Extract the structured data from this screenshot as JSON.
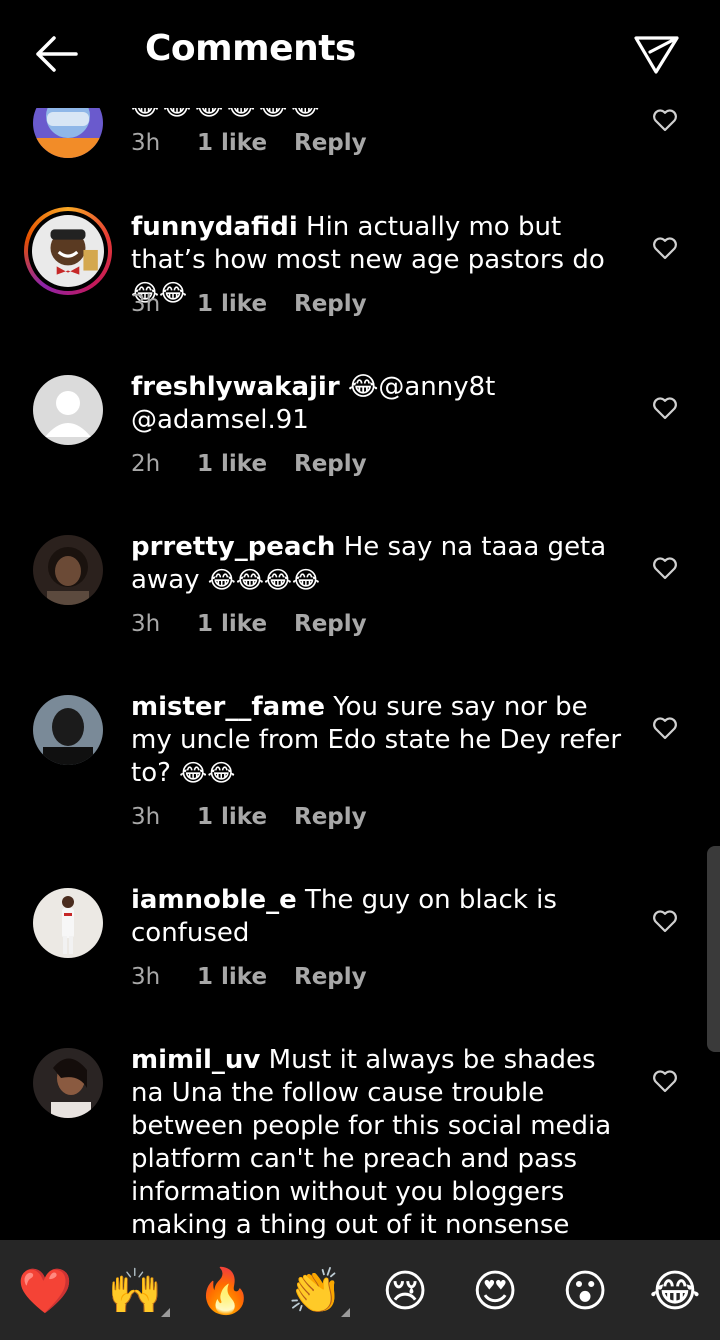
{
  "header": {
    "title": "Comments"
  },
  "icons": {
    "back": "back-arrow-icon",
    "share": "send-icon",
    "heart": "heart-outline-icon"
  },
  "partial_comment": {
    "time": "3h",
    "likes": "1 like",
    "reply": "Reply"
  },
  "comments": [
    {
      "username": "funnydafidi",
      "text": "Hin actually mo but that’s how most new age pastors do",
      "emojis": "😂😂",
      "time": "3h",
      "likes": "1 like",
      "reply": "Reply"
    },
    {
      "username": "freshlywakajir",
      "text": "😂@anny8t @adamsel.91",
      "emojis": "",
      "time": "2h",
      "likes": "1 like",
      "reply": "Reply"
    },
    {
      "username": "prretty_peach",
      "text": "He say na taaa geta away",
      "emojis": "😂😂😂😂",
      "time": "3h",
      "likes": "1 like",
      "reply": "Reply"
    },
    {
      "username": "mister__fame",
      "text": "You sure say nor be my uncle from Edo state he Dey refer to?",
      "emojis": "😂😂",
      "time": "3h",
      "likes": "1 like",
      "reply": "Reply"
    },
    {
      "username": "iamnoble_e",
      "text": "The guy on black is confused",
      "emojis": "",
      "time": "3h",
      "likes": "1 like",
      "reply": "Reply"
    },
    {
      "username": "mimil_uv",
      "text": "Must it always be shades na Una the follow cause trouble between people for this social media platform can't he preach and pass information without you bloggers making a thing out of it nonsense",
      "emojis": ""
    }
  ],
  "emoji_bar": [
    "❤️",
    "🙌",
    "🔥",
    "👏",
    "😢",
    "😍",
    "😮",
    "😂"
  ]
}
